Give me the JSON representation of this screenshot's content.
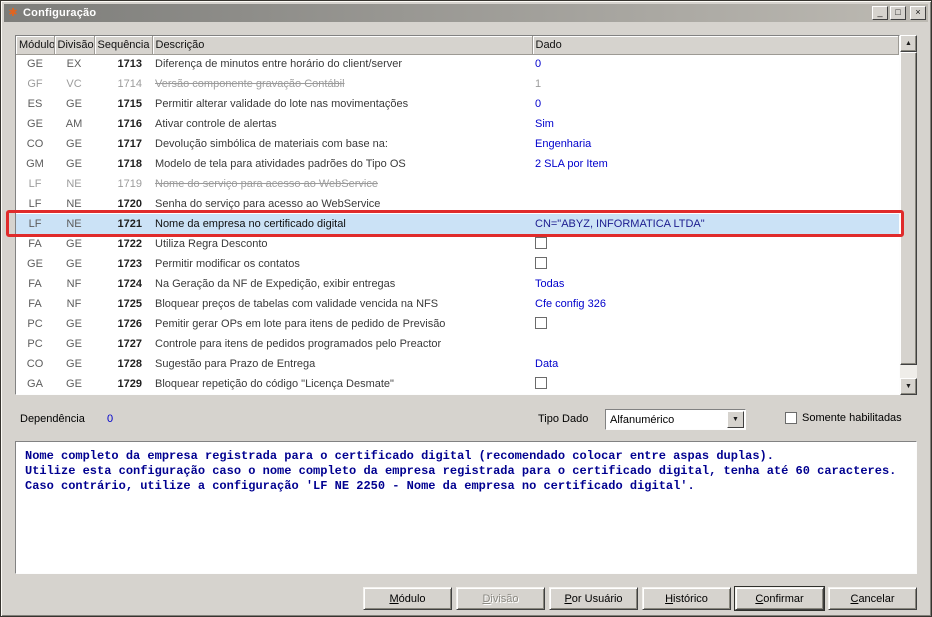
{
  "window": {
    "title": "Configuração",
    "minimize_glyph": "_",
    "maximize_glyph": "□",
    "close_glyph": "×"
  },
  "icons": {
    "app": "✱",
    "dropdown": "▼",
    "scroll_up": "▲",
    "scroll_down": "▼"
  },
  "table": {
    "columns": [
      "Módulo",
      "Divisão",
      "Sequência",
      "Descrição",
      "Dado"
    ],
    "rows": [
      {
        "modulo": "GE",
        "divisao": "EX",
        "seq": "1713",
        "desc": "Diferença de minutos entre horário do client/server",
        "dado": "0",
        "dado_type": "text",
        "state": "normal"
      },
      {
        "modulo": "GF",
        "divisao": "VC",
        "seq": "1714",
        "desc": "Versão componente gravação Contábil",
        "dado": "1",
        "dado_type": "text",
        "state": "strike"
      },
      {
        "modulo": "ES",
        "divisao": "GE",
        "seq": "1715",
        "desc": "Permitir alterar validade do lote nas movimentações",
        "dado": "0",
        "dado_type": "text",
        "state": "normal"
      },
      {
        "modulo": "GE",
        "divisao": "AM",
        "seq": "1716",
        "desc": "Ativar controle de alertas",
        "dado": "Sim",
        "dado_type": "text",
        "state": "normal"
      },
      {
        "modulo": "CO",
        "divisao": "GE",
        "seq": "1717",
        "desc": "Devolução simbólica de materiais com base na:",
        "dado": "Engenharia",
        "dado_type": "text",
        "state": "normal"
      },
      {
        "modulo": "GM",
        "divisao": "GE",
        "seq": "1718",
        "desc": "Modelo de tela para atividades padrões do Tipo OS",
        "dado": "2 SLA por Item",
        "dado_type": "text",
        "state": "normal"
      },
      {
        "modulo": "LF",
        "divisao": "NE",
        "seq": "1719",
        "desc": "Nome do serviço para acesso ao WebService",
        "dado": "",
        "dado_type": "text",
        "state": "strike"
      },
      {
        "modulo": "LF",
        "divisao": "NE",
        "seq": "1720",
        "desc": "Senha do serviço para acesso ao WebService",
        "dado": "",
        "dado_type": "text",
        "state": "normal"
      },
      {
        "modulo": "LF",
        "divisao": "NE",
        "seq": "1721",
        "desc": "Nome da empresa no certificado digital",
        "dado": "CN=\"ABYZ, INFORMATICA LTDA\"",
        "dado_type": "text",
        "state": "selected"
      },
      {
        "modulo": "FA",
        "divisao": "GE",
        "seq": "1722",
        "desc": "Utiliza Regra Desconto",
        "dado": "",
        "dado_type": "checkbox",
        "state": "normal"
      },
      {
        "modulo": "GE",
        "divisao": "GE",
        "seq": "1723",
        "desc": "Permitir modificar os contatos",
        "dado": "",
        "dado_type": "checkbox",
        "state": "normal"
      },
      {
        "modulo": "FA",
        "divisao": "NF",
        "seq": "1724",
        "desc": "Na Geração da NF de Expedição, exibir entregas",
        "dado": "Todas",
        "dado_type": "text",
        "state": "normal"
      },
      {
        "modulo": "FA",
        "divisao": "NF",
        "seq": "1725",
        "desc": "Bloquear preços de tabelas com validade vencida na NFS",
        "dado": "Cfe config 326",
        "dado_type": "text",
        "state": "normal"
      },
      {
        "modulo": "PC",
        "divisao": "GE",
        "seq": "1726",
        "desc": "Pemitir gerar OPs em lote para itens de pedido de Previsão",
        "dado": "",
        "dado_type": "checkbox",
        "state": "normal"
      },
      {
        "modulo": "PC",
        "divisao": "GE",
        "seq": "1727",
        "desc": "Controle para itens de pedidos programados pelo Preactor",
        "dado": "",
        "dado_type": "text",
        "state": "normal"
      },
      {
        "modulo": "CO",
        "divisao": "GE",
        "seq": "1728",
        "desc": "Sugestão para Prazo de Entrega",
        "dado": "Data",
        "dado_type": "text",
        "state": "normal"
      },
      {
        "modulo": "GA",
        "divisao": "GE",
        "seq": "1729",
        "desc": "Bloquear repetição do código \"Licença Desmate\"",
        "dado": "",
        "dado_type": "checkbox",
        "state": "normal"
      }
    ]
  },
  "fields": {
    "dependencia_label": "Dependência",
    "dependencia_value": "0",
    "tipo_dado_label": "Tipo Dado",
    "tipo_dado_value": "Alfanumérico",
    "somente_habilitadas_label": "Somente habilitadas"
  },
  "description": {
    "lines": [
      "Nome completo da empresa registrada para o certificado digital (recomendado colocar entre aspas duplas).",
      "Utilize esta configuração caso o nome completo da empresa registrada para o certificado digital, tenha até 60 caracteres.",
      "Caso contrário, utilize a configuração 'LF NE 2250 - Nome da empresa no certificado digital'."
    ]
  },
  "buttons": {
    "modulo": {
      "label": "Módulo",
      "key_index": 0
    },
    "divisao": {
      "label": "Divisão",
      "key_index": 0
    },
    "por_usuario": {
      "label": "Por Usuário",
      "key_index": 0
    },
    "historico": {
      "label": "Histórico",
      "key_index": 0
    },
    "confirmar": {
      "label": "Confirmar",
      "key_index": 0
    },
    "cancelar": {
      "label": "Cancelar",
      "key_index": 0
    }
  },
  "colors": {
    "accent_blue": "#0000cc",
    "selection_bg": "#cbe2f6",
    "annotation_red": "#e02b2b",
    "desc_text": "#000090"
  }
}
